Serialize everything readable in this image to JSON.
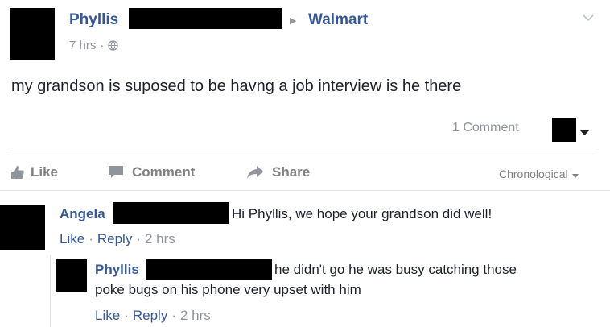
{
  "post": {
    "author_first": "Phyllis",
    "target_separator": "▶",
    "target": "Walmart",
    "time": "7 hrs",
    "dot": "·",
    "text": "my grandson is suposed to be havng a job interview is he there",
    "comment_count": "1 Comment"
  },
  "actions": {
    "like": "Like",
    "comment": "Comment",
    "share": "Share",
    "sort": "Chronological"
  },
  "comments": [
    {
      "author_first": "Angela",
      "text": "Hi Phyllis, we hope your grandson did well!",
      "like": "Like",
      "reply": "Reply",
      "time": "2 hrs"
    },
    {
      "author_first": "Phyllis",
      "text_line1": "he didn't go he was busy catching those",
      "text_line2": "poke bugs on his phone very upset with him",
      "like": "Like",
      "reply": "Reply",
      "time": "2 hrs"
    }
  ],
  "colors": {
    "link": "#365899",
    "meta": "#90949c",
    "text": "#1d2129",
    "divider": "#e5e5e5"
  }
}
